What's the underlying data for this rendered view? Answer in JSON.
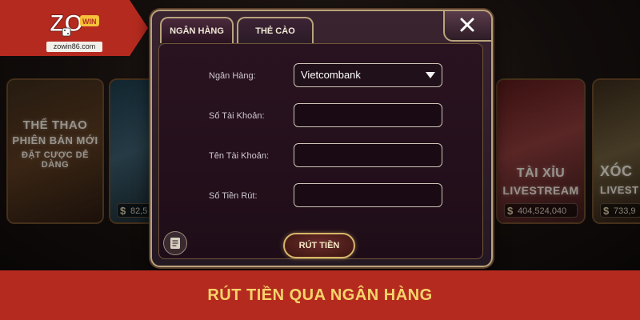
{
  "logo": {
    "badge_text": "ZO WIN",
    "url_text": "zowin86.com"
  },
  "background_cards": [
    {
      "lines": [
        "THỂ THAO",
        "PHIÊN BẢN MỚI",
        "ĐẶT CƯỢC DỄ DÀNG"
      ]
    },
    {
      "lines": [
        ""
      ],
      "amount": "82,5"
    },
    {
      "lines": [
        "TÀI XỈU",
        "LIVESTREAM"
      ],
      "amount": "404,524,040"
    },
    {
      "lines": [
        "XÓC",
        "LIVEST"
      ],
      "amount": "733,9"
    }
  ],
  "modal": {
    "tabs": {
      "bank": "NGÂN HÀNG",
      "card": "THẺ CÀO"
    },
    "form": {
      "bank_label": "Ngân Hàng:",
      "bank_value": "Vietcombank",
      "account_number_label": "Số Tài Khoản:",
      "account_name_label": "Tên Tài Khoản:",
      "amount_label": "Số Tiền Rút:",
      "submit_label": "RÚT TIỀN"
    }
  },
  "banner": {
    "text": "RÚT TIỀN QUA NGÂN HÀNG"
  },
  "colors": {
    "brand_red": "#b52a1f",
    "banner_text": "#f5d46a",
    "gold_border": "#b9a37c"
  }
}
